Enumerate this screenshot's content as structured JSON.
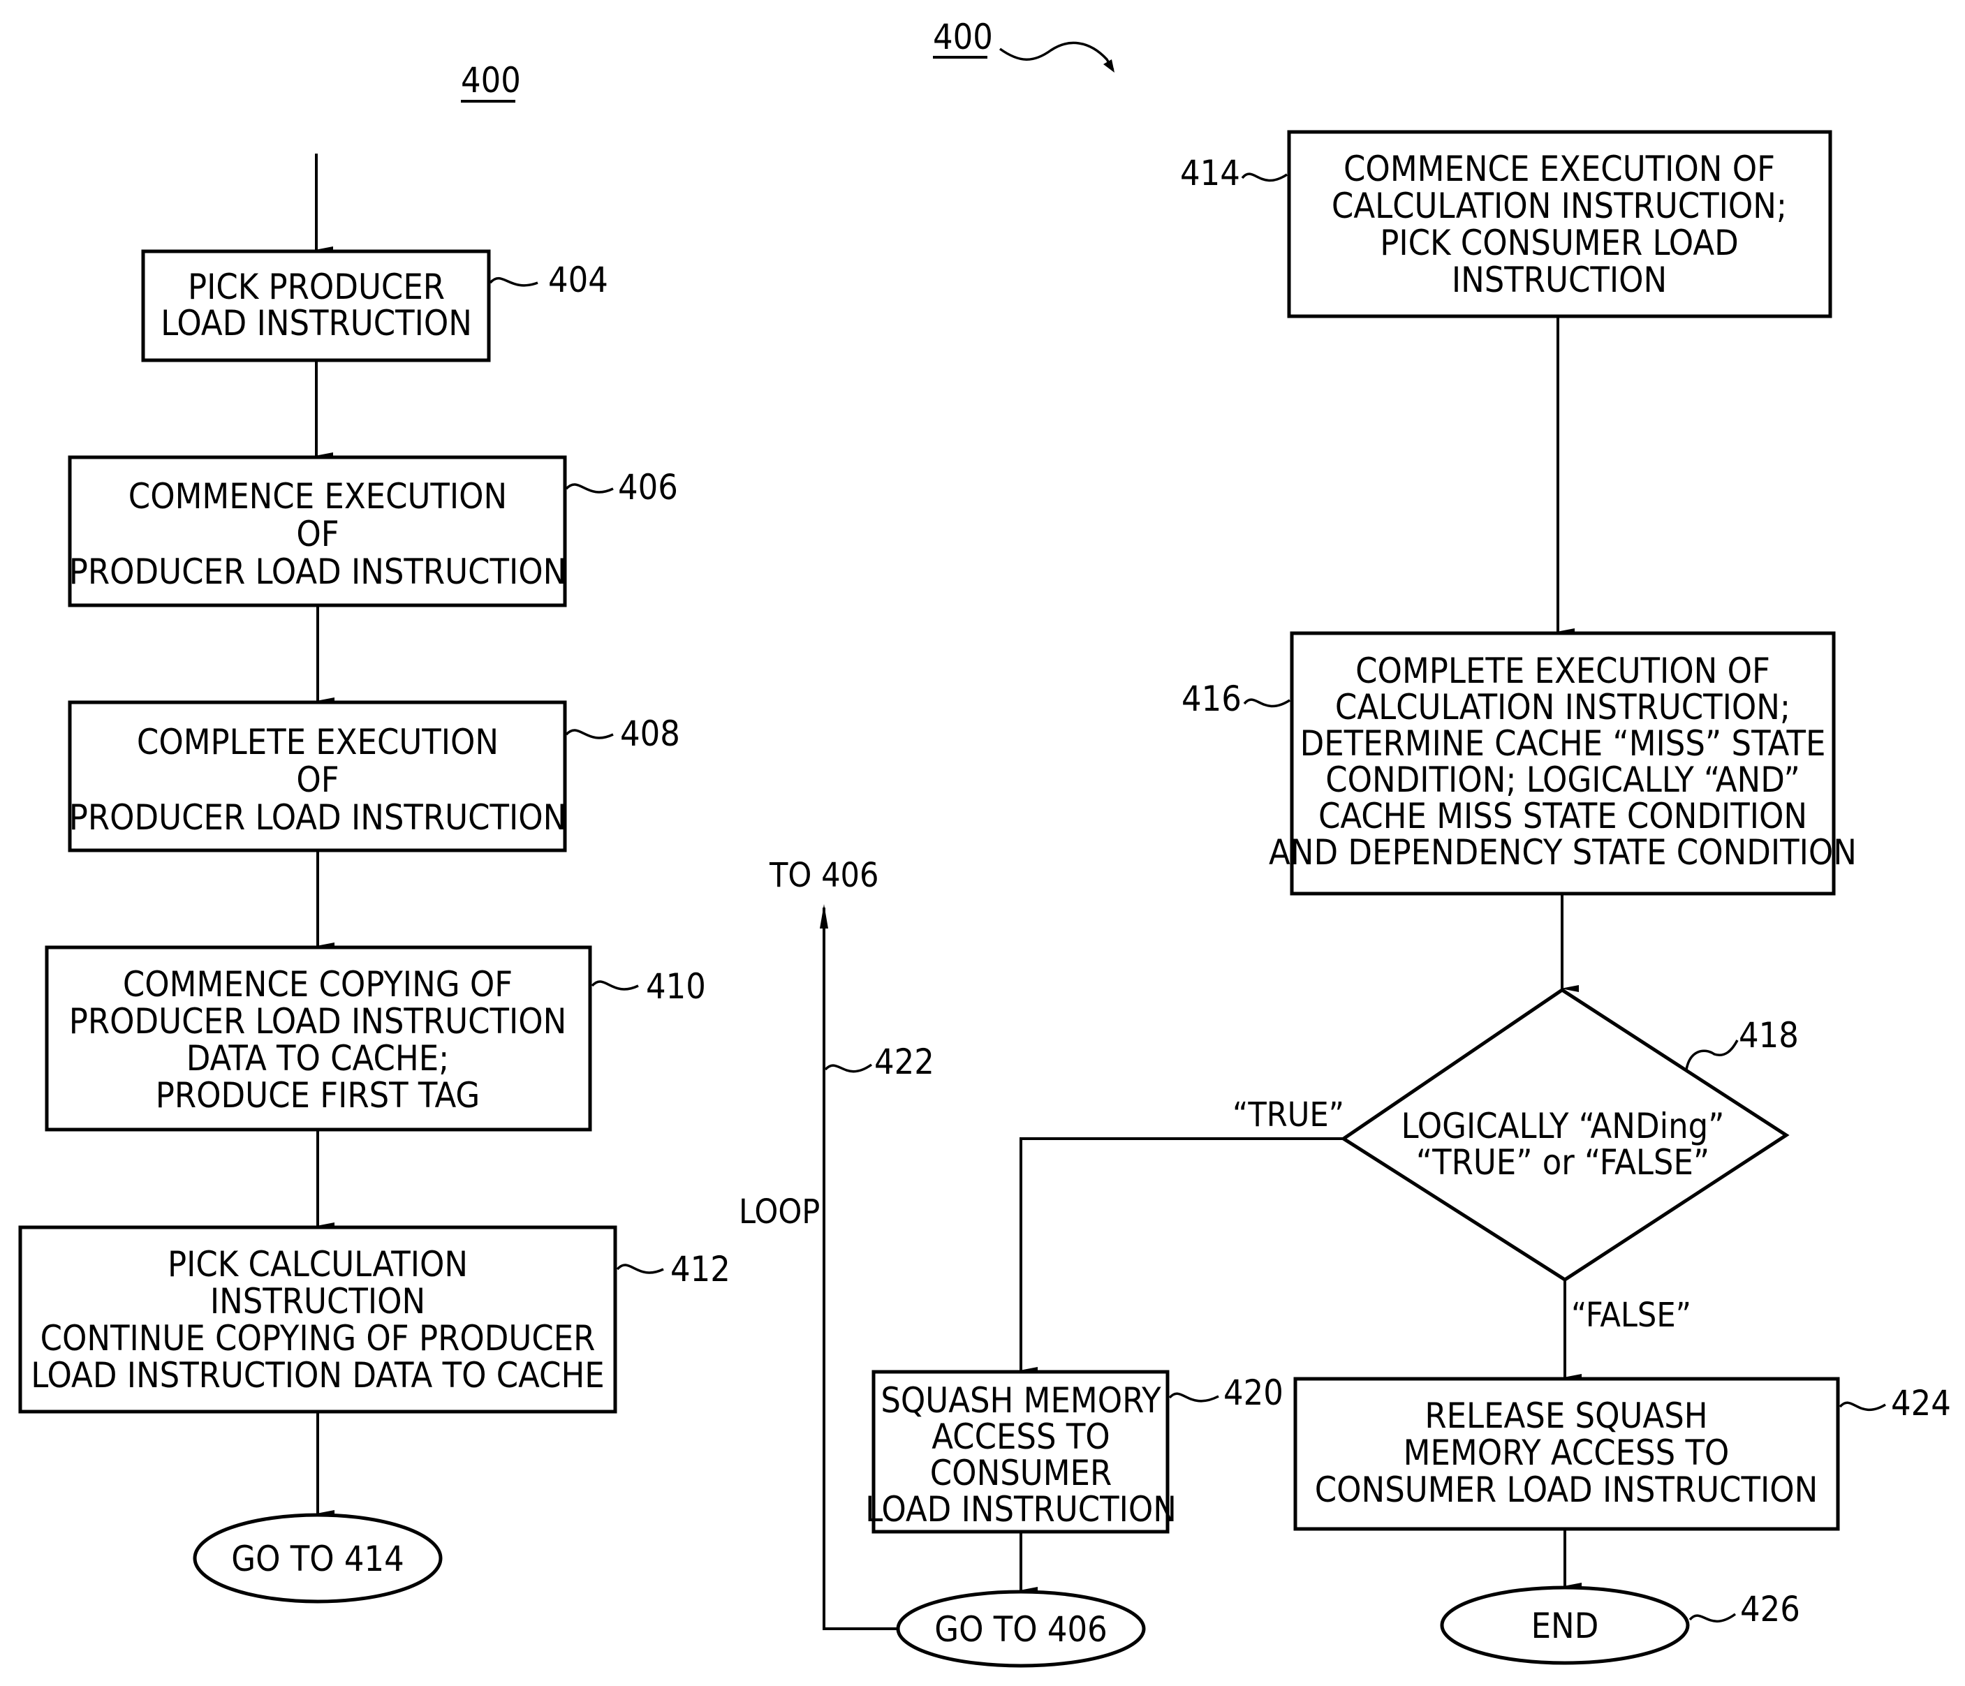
{
  "figure": {
    "label_left": "400",
    "label_top": "400"
  },
  "nodes": {
    "n404": {
      "ref": "404",
      "lines": [
        "PICK PRODUCER",
        "LOAD INSTRUCTION"
      ]
    },
    "n406": {
      "ref": "406",
      "lines": [
        "COMMENCE EXECUTION",
        "OF",
        "PRODUCER LOAD INSTRUCTION"
      ]
    },
    "n408": {
      "ref": "408",
      "lines": [
        "COMPLETE EXECUTION",
        "OF",
        "PRODUCER LOAD INSTRUCTION"
      ]
    },
    "n410": {
      "ref": "410",
      "lines": [
        "COMMENCE COPYING OF",
        "PRODUCER LOAD INSTRUCTION",
        "DATA TO CACHE;",
        "PRODUCE FIRST TAG"
      ]
    },
    "n412": {
      "ref": "412",
      "lines": [
        "PICK CALCULATION",
        "INSTRUCTION",
        "CONTINUE COPYING OF PRODUCER",
        "LOAD INSTRUCTION DATA TO CACHE"
      ]
    },
    "goto414": {
      "lines": [
        "GO TO 414"
      ]
    },
    "n414": {
      "ref": "414",
      "lines": [
        "COMMENCE EXECUTION OF",
        "CALCULATION INSTRUCTION;",
        "PICK CONSUMER LOAD",
        "INSTRUCTION"
      ]
    },
    "n416": {
      "ref": "416",
      "lines": [
        "COMPLETE EXECUTION OF",
        "CALCULATION INSTRUCTION;",
        "DETERMINE CACHE “MISS” STATE",
        "CONDITION; LOGICALLY “AND”",
        "CACHE MISS STATE CONDITION",
        "AND DEPENDENCY STATE CONDITION"
      ]
    },
    "n418": {
      "ref": "418",
      "lines": [
        "LOGICALLY “ANDing”",
        "“TRUE” or “FALSE”"
      ]
    },
    "n420": {
      "ref": "420",
      "lines": [
        "SQUASH MEMORY",
        "ACCESS TO",
        "CONSUMER",
        "LOAD INSTRUCTION"
      ]
    },
    "goto406": {
      "lines": [
        "GO TO 406"
      ]
    },
    "n424": {
      "ref": "424",
      "lines": [
        "RELEASE SQUASH",
        "MEMORY ACCESS TO",
        "CONSUMER LOAD INSTRUCTION"
      ]
    },
    "n426": {
      "ref": "426",
      "lines": [
        "END"
      ]
    }
  },
  "edges": {
    "true_label": "“TRUE”",
    "false_label": "“FALSE”",
    "loop_label": "LOOP",
    "loop_ref": "422",
    "loop_target": "TO 406"
  }
}
